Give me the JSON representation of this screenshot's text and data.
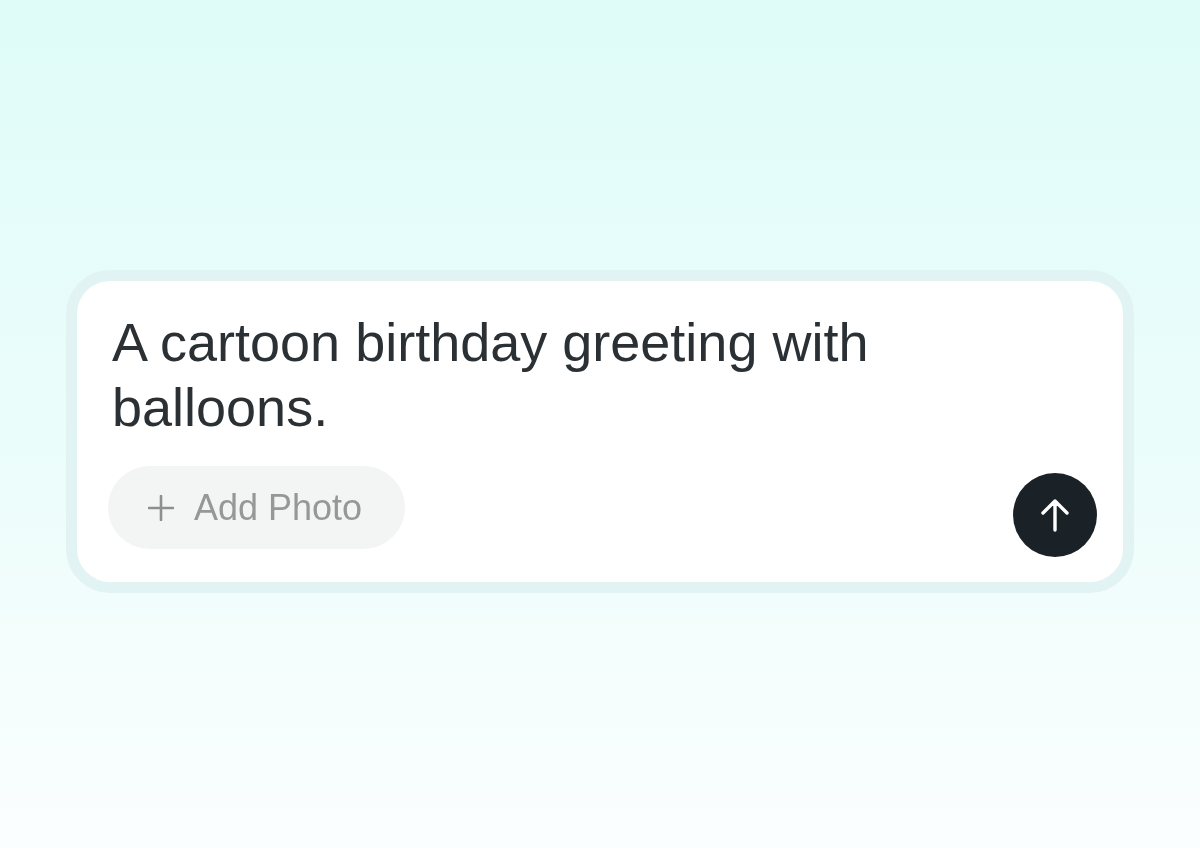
{
  "prompt": {
    "value": "A cartoon birthday greeting with balloons."
  },
  "add_photo_button": {
    "label": "Add Photo"
  }
}
